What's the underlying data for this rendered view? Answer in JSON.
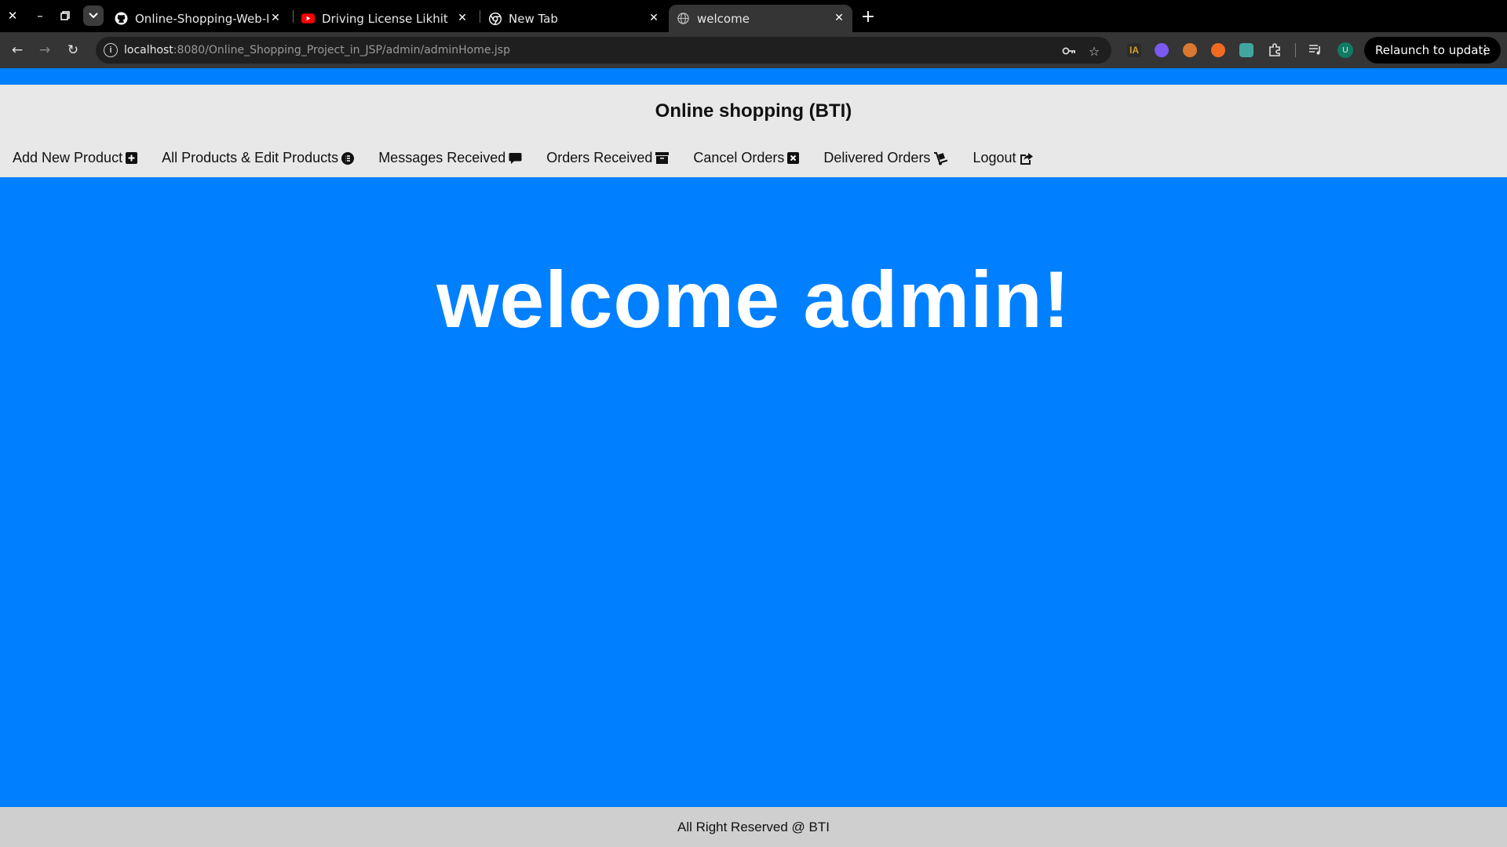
{
  "browser": {
    "tabs": [
      {
        "title": "Online-Shopping-Web-P",
        "favicon": "github-icon",
        "active": false
      },
      {
        "title": "Driving License Likhit Qu",
        "favicon": "youtube-icon",
        "active": false
      },
      {
        "title": "New Tab",
        "favicon": "chrome-icon",
        "active": false
      },
      {
        "title": "welcome",
        "favicon": "globe-icon",
        "active": true
      }
    ],
    "url_host": "localhost",
    "url_rest": ":8080/Online_Shopping_Project_in_JSP/admin/adminHome.jsp",
    "relaunch_label": "Relaunch to update",
    "profile_initial": "U"
  },
  "site": {
    "title": "Online shopping (BTI)",
    "nav": [
      {
        "label": "Add New Product",
        "icon": "plus-square-icon"
      },
      {
        "label": "All Products & Edit Products",
        "icon": "list-circle-icon"
      },
      {
        "label": "Messages Received",
        "icon": "comment-icon"
      },
      {
        "label": "Orders Received",
        "icon": "archive-box-icon"
      },
      {
        "label": "Cancel Orders",
        "icon": "x-square-icon"
      },
      {
        "label": "Delivered Orders",
        "icon": "dolly-icon"
      },
      {
        "label": "Logout",
        "icon": "share-square-icon"
      }
    ]
  },
  "main": {
    "heading": "welcome admin!"
  },
  "footer": {
    "text": "All Right Reserved @ BTI"
  },
  "colors": {
    "accent": "#0080ff",
    "header_bg": "#e8e8e8",
    "footer_bg": "#cfcfcf"
  }
}
